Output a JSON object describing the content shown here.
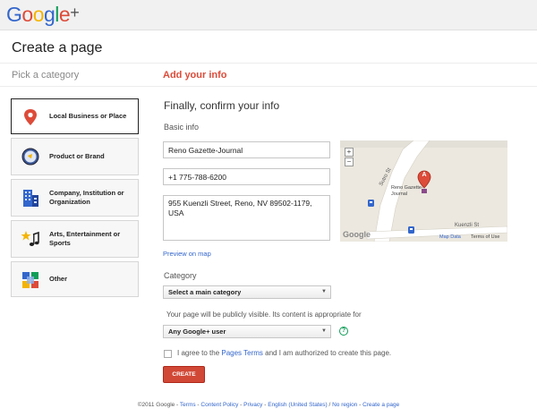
{
  "logo": {
    "text": "Google+"
  },
  "page_title": "Create a page",
  "steps": {
    "step1": "Pick a category",
    "step2": "Add your info"
  },
  "categories": [
    {
      "label": "Local Business or Place",
      "icon": "map-pin-icon",
      "selected": true
    },
    {
      "label": "Product or Brand",
      "icon": "product-icon",
      "selected": false
    },
    {
      "label": "Company, Institution or Organization",
      "icon": "building-icon",
      "selected": false
    },
    {
      "label": "Arts, Entertainment or Sports",
      "icon": "arts-icon",
      "selected": false
    },
    {
      "label": "Other",
      "icon": "other-icon",
      "selected": false
    }
  ],
  "form": {
    "title": "Finally, confirm your info",
    "basic_info": "Basic info",
    "name_value": "Reno Gazette-Journal",
    "phone_value": "+1 775-788-6200",
    "address_value": "955 Kuenzli Street, Reno, NV 89502-1179, USA",
    "preview_link": "Preview on map",
    "category_label": "Category",
    "category_select": "Select a main category",
    "visibility_text": "Your page will be publicly visible. Its content is appropriate for",
    "audience_select": "Any Google+ user",
    "help": "?",
    "agree_pre": "I agree to the ",
    "agree_link": "Pages Terms",
    "agree_post": " and I am authorized to create this page.",
    "create_button": "CREATE"
  },
  "map": {
    "marker": "A",
    "place_label": "Reno Gazette-Journal",
    "street1": "Sutro St",
    "street2": "Kuenzli St",
    "zoom_in": "+",
    "zoom_out": "−",
    "map_data": "Map Data",
    "terms": "Terms of Use",
    "brand": "Google"
  },
  "footer": {
    "copyright": "©2011 Google - ",
    "links": [
      "Terms",
      "Content Policy",
      "Privacy",
      "English (United States)",
      "No region",
      "Create a page"
    ]
  },
  "colors": {
    "accent": "#dd4b39",
    "link": "#3366cc",
    "button": "#d14836"
  }
}
